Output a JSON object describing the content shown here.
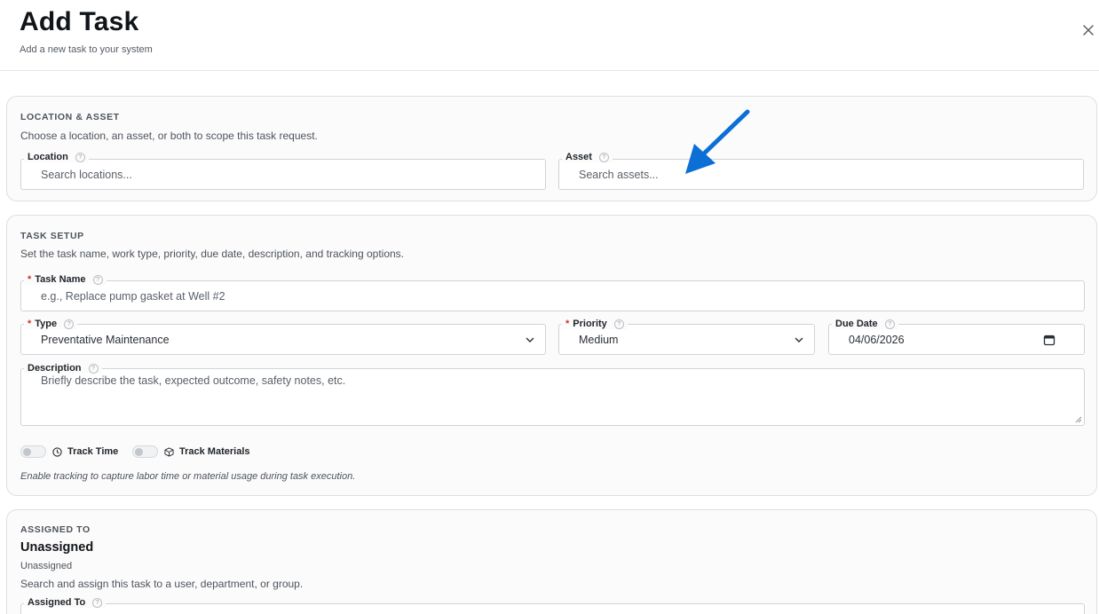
{
  "header": {
    "title": "Add Task",
    "subtitle": "Add a new task to your system",
    "close_icon": "close-icon"
  },
  "location_asset": {
    "heading": "LOCATION & ASSET",
    "description": "Choose a location, an asset, or both to scope this task request.",
    "location": {
      "label": "Location",
      "placeholder": "Search locations...",
      "value": ""
    },
    "asset": {
      "label": "Asset",
      "placeholder": "Search assets...",
      "value": ""
    }
  },
  "task_setup": {
    "heading": "TASK SETUP",
    "description": "Set the task name, work type, priority, due date, description, and tracking options.",
    "task_name": {
      "label": "Task Name",
      "required": "*",
      "placeholder": "e.g., Replace pump gasket at Well #2",
      "value": ""
    },
    "type": {
      "label": "Type",
      "required": "*",
      "value": "Preventative Maintenance"
    },
    "priority": {
      "label": "Priority",
      "required": "*",
      "value": "Medium"
    },
    "due_date": {
      "label": "Due Date",
      "value": "04/06/2026"
    },
    "description_field": {
      "label": "Description",
      "placeholder": "Briefly describe the task, expected outcome, safety notes, etc.",
      "value": ""
    },
    "track_time": {
      "label": "Track Time",
      "enabled": false,
      "icon": "clock-icon"
    },
    "track_materials": {
      "label": "Track Materials",
      "enabled": false,
      "icon": "box-icon"
    },
    "hint": "Enable tracking to capture labor time or material usage during task execution."
  },
  "assigned_to": {
    "heading": "ASSIGNED TO",
    "current": "Unassigned",
    "current_sub": "Unassigned",
    "description": "Search and assign this task to a user, department, or group.",
    "field_label": "Assigned To"
  },
  "colors": {
    "required": "#d0342c",
    "annotation_arrow": "#0b6fd6",
    "border": "#dcdfe3"
  }
}
